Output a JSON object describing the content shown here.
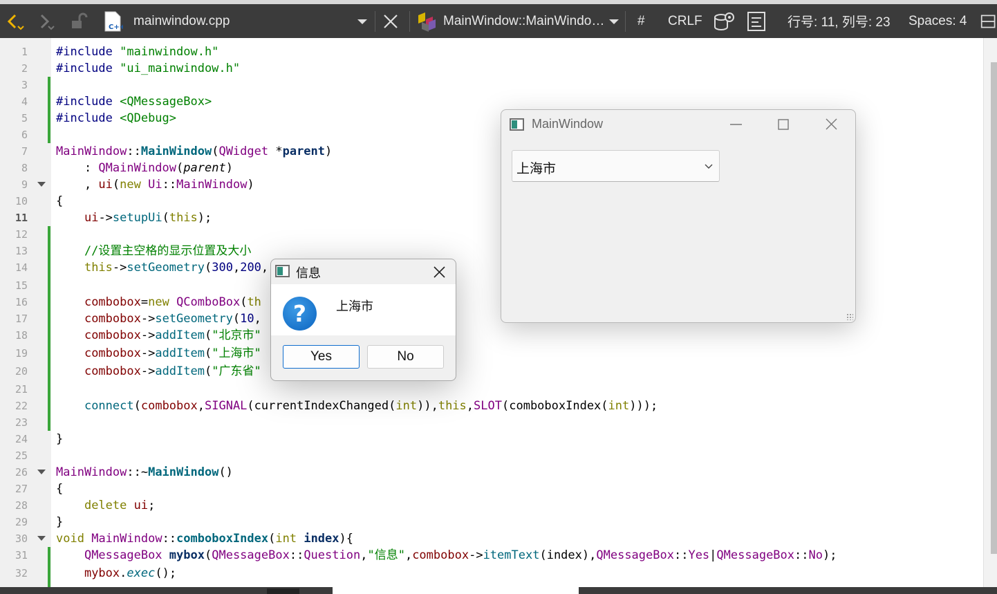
{
  "toolbar": {
    "file_name": "mainwindow.cpp",
    "file_icon_label": "C++",
    "symbol": "MainWindow::MainWindo…",
    "hash": "#",
    "line_ending": "CRLF",
    "cursor_pos": "行号: 11, 列号: 23",
    "indent": "Spaces: 4"
  },
  "editor": {
    "current_line": 11,
    "line_numbers": [
      "1",
      "2",
      "3",
      "4",
      "5",
      "6",
      "7",
      "8",
      "9",
      "10",
      "11",
      "12",
      "13",
      "14",
      "15",
      "16",
      "17",
      "18",
      "19",
      "20",
      "21",
      "22",
      "23",
      "24",
      "25",
      "26",
      "27",
      "28",
      "29",
      "30",
      "31",
      "32"
    ],
    "code": {
      "l1": [
        "#include ",
        "\"mainwindow.h\""
      ],
      "l2": [
        "#include ",
        "\"ui_mainwindow.h\""
      ],
      "l4": [
        "#include ",
        "<QMessageBox>"
      ],
      "l5": [
        "#include ",
        "<QDebug>"
      ],
      "l7": [
        "MainWindow",
        "::",
        "MainWindow",
        "(",
        "QWidget",
        " *",
        "parent",
        ")"
      ],
      "l8": [
        "    : ",
        "QMainWindow",
        "(",
        "parent",
        ")"
      ],
      "l9": [
        "    , ",
        "ui",
        "(",
        "new",
        " ",
        "Ui",
        "::",
        "MainWindow",
        ")"
      ],
      "l10": [
        "{"
      ],
      "l11": [
        "    ",
        "ui",
        "->",
        "setupUi",
        "(",
        "this",
        ");"
      ],
      "l13": [
        "    //设置主空格的显示位置及大小"
      ],
      "l14": [
        "    ",
        "this",
        "->",
        "setGeometry",
        "(",
        "300",
        ",",
        "200",
        ","
      ],
      "l16": [
        "    ",
        "combobox",
        "=",
        "new",
        " ",
        "QComboBox",
        "(",
        "th"
      ],
      "l17": [
        "    ",
        "combobox",
        "->",
        "setGeometry",
        "(",
        "10",
        ","
      ],
      "l18": [
        "    ",
        "combobox",
        "->",
        "addItem",
        "(",
        "\"北京市\""
      ],
      "l19": [
        "    ",
        "combobox",
        "->",
        "addItem",
        "(",
        "\"上海市\""
      ],
      "l20": [
        "    ",
        "combobox",
        "->",
        "addItem",
        "(",
        "\"广东省\""
      ],
      "l22": [
        "    ",
        "connect",
        "(",
        "combobox",
        ",",
        "SIGNAL",
        "(",
        "currentIndexChanged",
        "(",
        "int",
        ")),",
        "this",
        ",",
        "SLOT",
        "(",
        "comboboxIndex",
        "(",
        "int",
        ")));"
      ],
      "l24": [
        "}"
      ],
      "l26": [
        "MainWindow",
        "::~",
        "MainWindow",
        "()"
      ],
      "l27": [
        "{"
      ],
      "l28": [
        "    ",
        "delete",
        " ",
        "ui",
        ";"
      ],
      "l29": [
        "}"
      ],
      "l30": [
        "void",
        " ",
        "MainWindow",
        "::",
        "comboboxIndex",
        "(",
        "int",
        " ",
        "index",
        "){"
      ],
      "l31": [
        "    ",
        "QMessageBox",
        " ",
        "mybox",
        "(",
        "QMessageBox",
        "::",
        "Question",
        ",",
        "\"信息\"",
        ",",
        "combobox",
        "->",
        "itemText",
        "(",
        "index",
        "),",
        "QMessageBox",
        "::",
        "Yes",
        "|",
        "QMessageBox",
        "::",
        "No",
        ");"
      ],
      "l32": [
        "    ",
        "mybox",
        ".",
        "exec",
        "();"
      ]
    }
  },
  "main_window": {
    "title": "MainWindow",
    "combo_value": "上海市"
  },
  "message_box": {
    "title": "信息",
    "text": "上海市",
    "icon": "question-icon",
    "yes_label": "Yes",
    "no_label": "No"
  }
}
